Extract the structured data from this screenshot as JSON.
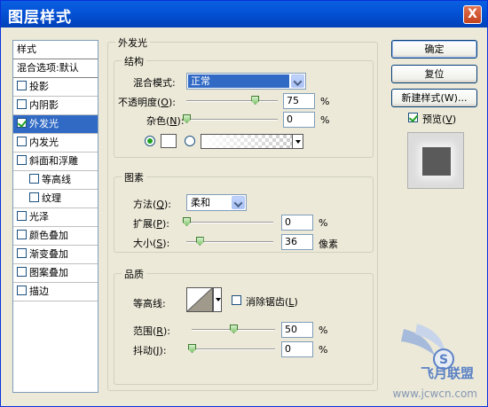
{
  "window": {
    "title": "图层样式",
    "close_label": "X"
  },
  "styles_list": {
    "header": "样式",
    "blend_options": "混合选项:默认",
    "items": [
      {
        "label": "投影",
        "checked": false,
        "indent": false,
        "selected": false
      },
      {
        "label": "内阴影",
        "checked": false,
        "indent": false,
        "selected": false
      },
      {
        "label": "外发光",
        "checked": true,
        "indent": false,
        "selected": true
      },
      {
        "label": "内发光",
        "checked": false,
        "indent": false,
        "selected": false
      },
      {
        "label": "斜面和浮雕",
        "checked": false,
        "indent": false,
        "selected": false
      },
      {
        "label": "等高线",
        "checked": false,
        "indent": true,
        "selected": false
      },
      {
        "label": "纹理",
        "checked": false,
        "indent": true,
        "selected": false
      },
      {
        "label": "光泽",
        "checked": false,
        "indent": false,
        "selected": false
      },
      {
        "label": "颜色叠加",
        "checked": false,
        "indent": false,
        "selected": false
      },
      {
        "label": "渐变叠加",
        "checked": false,
        "indent": false,
        "selected": false
      },
      {
        "label": "图案叠加",
        "checked": false,
        "indent": false,
        "selected": false
      },
      {
        "label": "描边",
        "checked": false,
        "indent": false,
        "selected": false
      }
    ]
  },
  "outer_glow": {
    "title": "外发光",
    "structure": {
      "title": "结构",
      "blend_mode_label": "混合模式:",
      "blend_mode_value": "正常",
      "opacity_label_pre": "不透明度(",
      "opacity_key": "O",
      "opacity_label_post": "):",
      "opacity_value": "75",
      "opacity_unit": "%",
      "opacity_level": 0.75,
      "noise_label_pre": "杂色(",
      "noise_key": "N",
      "noise_label_post": "):",
      "noise_value": "0",
      "noise_unit": "%",
      "noise_level": 0,
      "color_mode": "solid",
      "solid_color": "#ffffff"
    },
    "elements": {
      "title": "图素",
      "technique_label_pre": "方法(",
      "technique_key": "Q",
      "technique_label_post": "):",
      "technique_value": "柔和",
      "spread_label_pre": "扩展(",
      "spread_key": "P",
      "spread_label_post": "):",
      "spread_value": "0",
      "spread_unit": "%",
      "spread_level": 0,
      "size_label_pre": "大小(",
      "size_key": "S",
      "size_label_post": "):",
      "size_value": "36",
      "size_unit": "像素",
      "size_level": 0.15
    },
    "quality": {
      "title": "品质",
      "contour_label": "等高线:",
      "anti_alias_label_pre": "消除锯齿(",
      "anti_alias_key": "L",
      "anti_alias_label_post": ")",
      "anti_alias_checked": false,
      "range_label_pre": "范围(",
      "range_key": "R",
      "range_label_post": "):",
      "range_value": "50",
      "range_unit": "%",
      "range_level": 0.5,
      "jitter_label_pre": "抖动(",
      "jitter_key": "J",
      "jitter_label_post": "):",
      "jitter_value": "0",
      "jitter_unit": "%",
      "jitter_level": 0
    }
  },
  "buttons": {
    "ok": "确定",
    "reset": "复位",
    "new_style": "新建样式(W)...",
    "preview_label_pre": "预览(",
    "preview_key": "V",
    "preview_label_post": ")",
    "preview_checked": true
  },
  "watermark": {
    "brand": "飞月联盟",
    "site": "www.jcwcn.com"
  },
  "colors": {
    "title_bar": "#0554d8",
    "selection": "#316ac5",
    "slider_thumb": "#7fc36b"
  }
}
